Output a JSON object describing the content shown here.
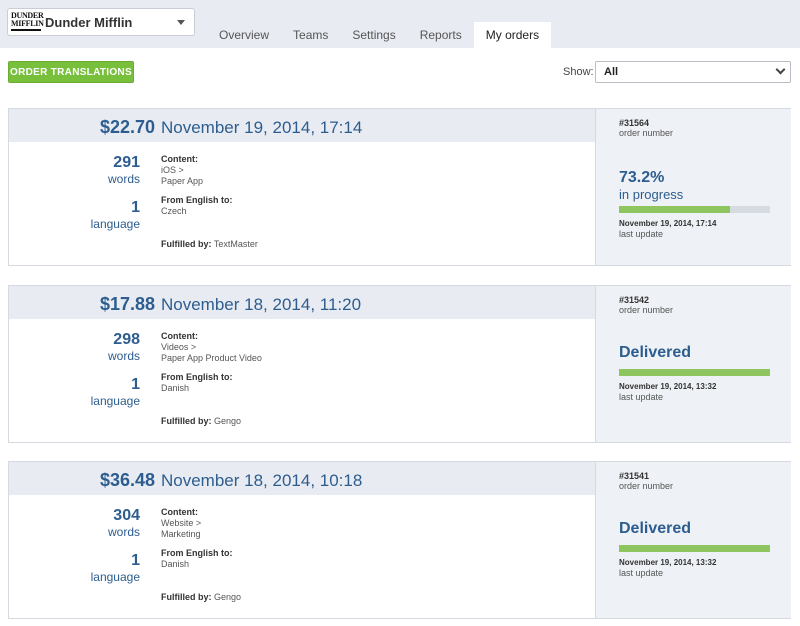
{
  "company": {
    "name": "Dunder Mifflin",
    "logo_line1": "DUNDER",
    "logo_line2": "MIFFLIN"
  },
  "tabs": [
    {
      "label": "Overview",
      "active": false
    },
    {
      "label": "Teams",
      "active": false
    },
    {
      "label": "Settings",
      "active": false
    },
    {
      "label": "Reports",
      "active": false
    },
    {
      "label": "My orders",
      "active": true
    }
  ],
  "toolbar": {
    "order_button": "ORDER TRANSLATIONS",
    "show_label": "Show:",
    "show_value": "All"
  },
  "colors": {
    "accent": "#78bf3c",
    "primary_text": "#2d5d8f",
    "progress_fill": "#8ec55e"
  },
  "orders": [
    {
      "price": "$22.70",
      "date": "November 19, 2014, 17:14",
      "words": "291",
      "words_label": "words",
      "languages": "1",
      "languages_label": "language",
      "content_label": "Content:",
      "content_line1": "iOS >",
      "content_line2": "Paper App",
      "from_label": "From English to:",
      "to_lang": "Czech",
      "fulfilled_label": "Fulfilled by:",
      "fulfilled_by": "TextMaster",
      "order_number": "#31564",
      "order_number_label": "order number",
      "status": "73.2%",
      "status_detail": "in progress",
      "progress": 0.732,
      "last_update": "November 19, 2014, 17:14",
      "last_update_label": "last update"
    },
    {
      "price": "$17.88",
      "date": "November 18, 2014, 11:20",
      "words": "298",
      "words_label": "words",
      "languages": "1",
      "languages_label": "language",
      "content_label": "Content:",
      "content_line1": "Videos >",
      "content_line2": "Paper App Product Video",
      "from_label": "From English to:",
      "to_lang": "Danish",
      "fulfilled_label": "Fulfilled by:",
      "fulfilled_by": "Gengo",
      "order_number": "#31542",
      "order_number_label": "order number",
      "status": "Delivered",
      "progress": 1.0,
      "last_update": "November 19, 2014, 13:32",
      "last_update_label": "last update"
    },
    {
      "price": "$36.48",
      "date": "November 18, 2014, 10:18",
      "words": "304",
      "words_label": "words",
      "languages": "1",
      "languages_label": "language",
      "content_label": "Content:",
      "content_line1": "Website >",
      "content_line2": "Marketing",
      "from_label": "From English to:",
      "to_lang": "Danish",
      "fulfilled_label": "Fulfilled by:",
      "fulfilled_by": "Gengo",
      "order_number": "#31541",
      "order_number_label": "order number",
      "status": "Delivered",
      "progress": 1.0,
      "last_update": "November 19, 2014, 13:32",
      "last_update_label": "last update"
    }
  ]
}
